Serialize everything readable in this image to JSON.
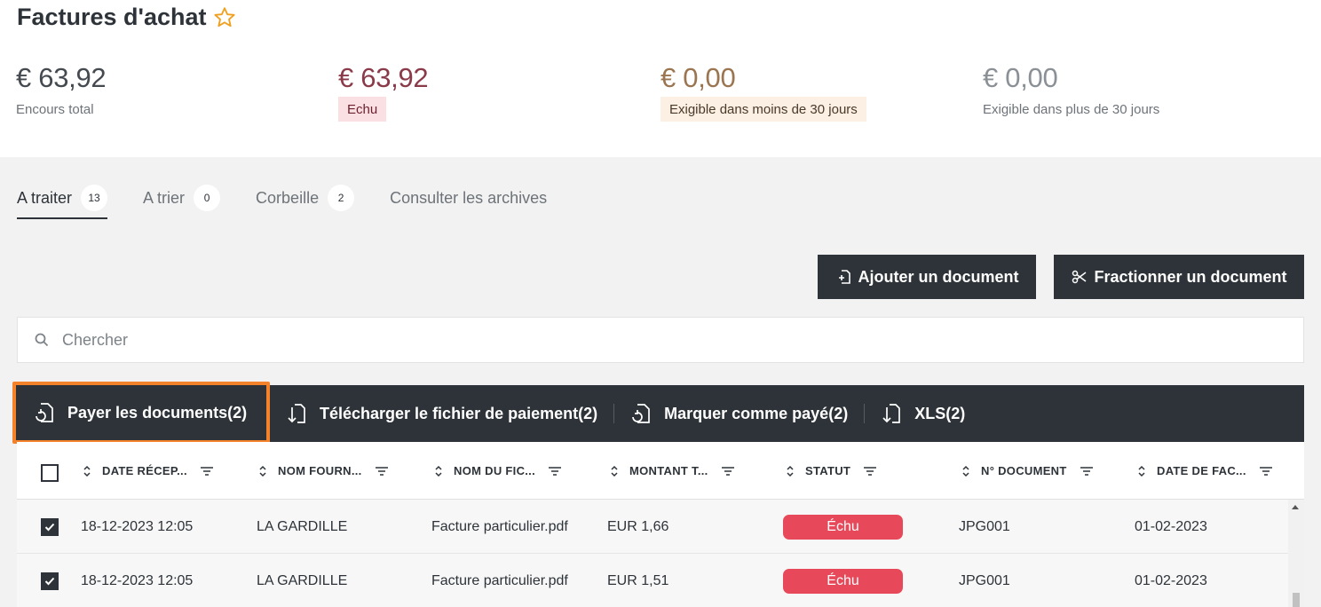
{
  "header": {
    "title": "Factures d'achat"
  },
  "kpis": [
    {
      "amount": "€ 63,92",
      "label": "Encours total"
    },
    {
      "amount": "€ 63,92",
      "label": "Echu"
    },
    {
      "amount": "€ 0,00",
      "label": "Exigible dans moins de 30 jours"
    },
    {
      "amount": "€ 0,00",
      "label": "Exigible dans plus de 30 jours"
    }
  ],
  "tabs": [
    {
      "label": "A traiter",
      "count": "13"
    },
    {
      "label": "A trier",
      "count": "0"
    },
    {
      "label": "Corbeille",
      "count": "2"
    },
    {
      "label": "Consulter les archives"
    }
  ],
  "toolbar": {
    "add_label": "Ajouter un document",
    "split_label": "Fractionner un document"
  },
  "search": {
    "placeholder": "Chercher"
  },
  "actions": {
    "pay": "Payer les documents(2)",
    "download": "Télécharger le fichier de paiement(2)",
    "mark_paid": "Marquer comme payé(2)",
    "xls": "XLS(2)"
  },
  "table": {
    "columns": [
      "DATE RÉCEP...",
      "NOM FOURN...",
      "NOM DU FIC...",
      "MONTANT T...",
      "STATUT",
      "N° DOCUMENT",
      "DATE DE FAC..."
    ],
    "rows": [
      {
        "checked": true,
        "cells": [
          "18-12-2023 12:05",
          "LA GARDILLE",
          "Facture particulier.pdf",
          "EUR 1,66",
          "Échu",
          "JPG001",
          "01-02-2023"
        ]
      },
      {
        "checked": true,
        "cells": [
          "18-12-2023 12:05",
          "LA GARDILLE",
          "Facture particulier.pdf",
          "EUR 1,51",
          "Échu",
          "JPG001",
          "01-02-2023"
        ]
      }
    ]
  },
  "colors": {
    "dark": "#2d3338",
    "accent_orange": "#f3822a",
    "status_red": "#e8495a",
    "star": "#f0a020"
  },
  "icons": [
    "star-outline-icon",
    "file-add-icon",
    "scissors-icon",
    "search-icon",
    "file-pay-icon",
    "file-download-icon",
    "sort-icon",
    "filter-icon",
    "check-icon"
  ]
}
